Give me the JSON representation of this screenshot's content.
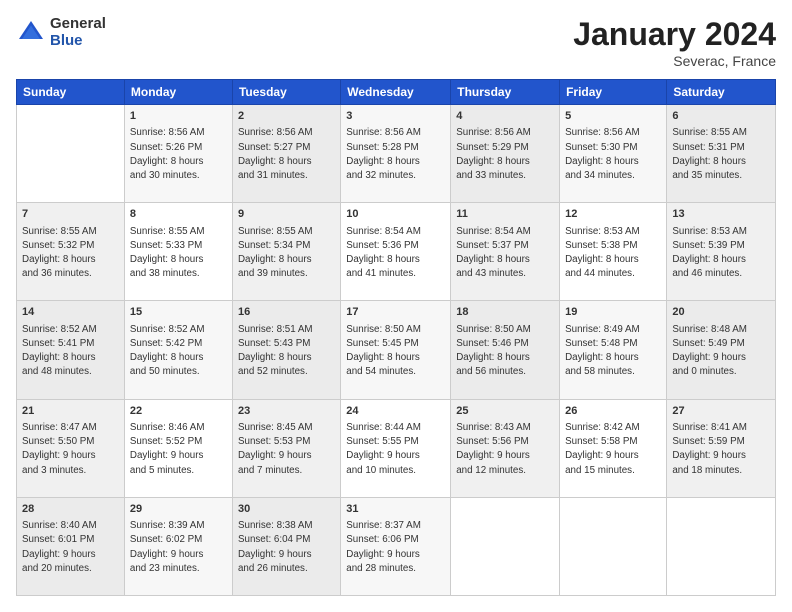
{
  "logo": {
    "general": "General",
    "blue": "Blue"
  },
  "header": {
    "month": "January 2024",
    "location": "Severac, France"
  },
  "weekdays": [
    "Sunday",
    "Monday",
    "Tuesday",
    "Wednesday",
    "Thursday",
    "Friday",
    "Saturday"
  ],
  "weeks": [
    [
      {
        "day": "",
        "info": ""
      },
      {
        "day": "1",
        "info": "Sunrise: 8:56 AM\nSunset: 5:26 PM\nDaylight: 8 hours\nand 30 minutes."
      },
      {
        "day": "2",
        "info": "Sunrise: 8:56 AM\nSunset: 5:27 PM\nDaylight: 8 hours\nand 31 minutes."
      },
      {
        "day": "3",
        "info": "Sunrise: 8:56 AM\nSunset: 5:28 PM\nDaylight: 8 hours\nand 32 minutes."
      },
      {
        "day": "4",
        "info": "Sunrise: 8:56 AM\nSunset: 5:29 PM\nDaylight: 8 hours\nand 33 minutes."
      },
      {
        "day": "5",
        "info": "Sunrise: 8:56 AM\nSunset: 5:30 PM\nDaylight: 8 hours\nand 34 minutes."
      },
      {
        "day": "6",
        "info": "Sunrise: 8:55 AM\nSunset: 5:31 PM\nDaylight: 8 hours\nand 35 minutes."
      }
    ],
    [
      {
        "day": "7",
        "info": "Sunrise: 8:55 AM\nSunset: 5:32 PM\nDaylight: 8 hours\nand 36 minutes."
      },
      {
        "day": "8",
        "info": "Sunrise: 8:55 AM\nSunset: 5:33 PM\nDaylight: 8 hours\nand 38 minutes."
      },
      {
        "day": "9",
        "info": "Sunrise: 8:55 AM\nSunset: 5:34 PM\nDaylight: 8 hours\nand 39 minutes."
      },
      {
        "day": "10",
        "info": "Sunrise: 8:54 AM\nSunset: 5:36 PM\nDaylight: 8 hours\nand 41 minutes."
      },
      {
        "day": "11",
        "info": "Sunrise: 8:54 AM\nSunset: 5:37 PM\nDaylight: 8 hours\nand 43 minutes."
      },
      {
        "day": "12",
        "info": "Sunrise: 8:53 AM\nSunset: 5:38 PM\nDaylight: 8 hours\nand 44 minutes."
      },
      {
        "day": "13",
        "info": "Sunrise: 8:53 AM\nSunset: 5:39 PM\nDaylight: 8 hours\nand 46 minutes."
      }
    ],
    [
      {
        "day": "14",
        "info": "Sunrise: 8:52 AM\nSunset: 5:41 PM\nDaylight: 8 hours\nand 48 minutes."
      },
      {
        "day": "15",
        "info": "Sunrise: 8:52 AM\nSunset: 5:42 PM\nDaylight: 8 hours\nand 50 minutes."
      },
      {
        "day": "16",
        "info": "Sunrise: 8:51 AM\nSunset: 5:43 PM\nDaylight: 8 hours\nand 52 minutes."
      },
      {
        "day": "17",
        "info": "Sunrise: 8:50 AM\nSunset: 5:45 PM\nDaylight: 8 hours\nand 54 minutes."
      },
      {
        "day": "18",
        "info": "Sunrise: 8:50 AM\nSunset: 5:46 PM\nDaylight: 8 hours\nand 56 minutes."
      },
      {
        "day": "19",
        "info": "Sunrise: 8:49 AM\nSunset: 5:48 PM\nDaylight: 8 hours\nand 58 minutes."
      },
      {
        "day": "20",
        "info": "Sunrise: 8:48 AM\nSunset: 5:49 PM\nDaylight: 9 hours\nand 0 minutes."
      }
    ],
    [
      {
        "day": "21",
        "info": "Sunrise: 8:47 AM\nSunset: 5:50 PM\nDaylight: 9 hours\nand 3 minutes."
      },
      {
        "day": "22",
        "info": "Sunrise: 8:46 AM\nSunset: 5:52 PM\nDaylight: 9 hours\nand 5 minutes."
      },
      {
        "day": "23",
        "info": "Sunrise: 8:45 AM\nSunset: 5:53 PM\nDaylight: 9 hours\nand 7 minutes."
      },
      {
        "day": "24",
        "info": "Sunrise: 8:44 AM\nSunset: 5:55 PM\nDaylight: 9 hours\nand 10 minutes."
      },
      {
        "day": "25",
        "info": "Sunrise: 8:43 AM\nSunset: 5:56 PM\nDaylight: 9 hours\nand 12 minutes."
      },
      {
        "day": "26",
        "info": "Sunrise: 8:42 AM\nSunset: 5:58 PM\nDaylight: 9 hours\nand 15 minutes."
      },
      {
        "day": "27",
        "info": "Sunrise: 8:41 AM\nSunset: 5:59 PM\nDaylight: 9 hours\nand 18 minutes."
      }
    ],
    [
      {
        "day": "28",
        "info": "Sunrise: 8:40 AM\nSunset: 6:01 PM\nDaylight: 9 hours\nand 20 minutes."
      },
      {
        "day": "29",
        "info": "Sunrise: 8:39 AM\nSunset: 6:02 PM\nDaylight: 9 hours\nand 23 minutes."
      },
      {
        "day": "30",
        "info": "Sunrise: 8:38 AM\nSunset: 6:04 PM\nDaylight: 9 hours\nand 26 minutes."
      },
      {
        "day": "31",
        "info": "Sunrise: 8:37 AM\nSunset: 6:06 PM\nDaylight: 9 hours\nand 28 minutes."
      },
      {
        "day": "",
        "info": ""
      },
      {
        "day": "",
        "info": ""
      },
      {
        "day": "",
        "info": ""
      }
    ]
  ]
}
